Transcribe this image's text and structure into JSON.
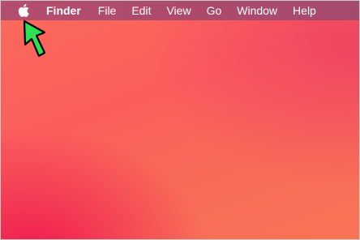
{
  "menubar": {
    "apple_icon": "apple-icon",
    "app_name": "Finder",
    "items": [
      "File",
      "Edit",
      "View",
      "Go",
      "Window",
      "Help"
    ]
  },
  "annotation": {
    "icon": "pointer-arrow-icon",
    "color": "#2fe052"
  },
  "colors": {
    "menubar": "#ad4a6c",
    "wallpaper_primary": "#fa5e5c",
    "wallpaper_accent": "#f0174f"
  }
}
